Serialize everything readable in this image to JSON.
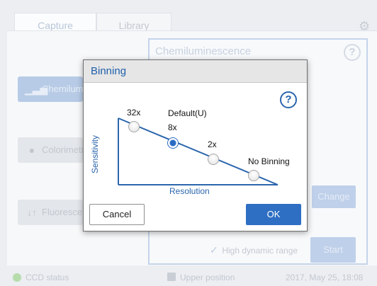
{
  "tabs": [
    {
      "label": "Capture"
    },
    {
      "label": "Library"
    }
  ],
  "sidebar": {
    "items": [
      {
        "label": "Chemiluminescence"
      },
      {
        "label": "Colorimetric"
      },
      {
        "label": "Fluorescence"
      }
    ]
  },
  "main": {
    "panel_title": "Chemiluminescence",
    "help_glyph": "?",
    "change_label": "Change",
    "start_label": "Start",
    "hdr_label": "High dynamic range",
    "hdr_checked": true
  },
  "status": {
    "ccd": "CCD status",
    "position": "Upper position",
    "datetime": "2017, May 25, 18:08"
  },
  "dialog": {
    "title": "Binning",
    "help_glyph": "?",
    "y_axis": "Sensitivity",
    "x_axis": "Resolution",
    "options": [
      {
        "label": "32x",
        "selected": false
      },
      {
        "label": "8x",
        "caption": "Default(U)",
        "selected": true
      },
      {
        "label": "2x",
        "selected": false
      },
      {
        "label": "No Binning",
        "selected": false
      }
    ],
    "cancel_label": "Cancel",
    "ok_label": "OK"
  },
  "colors": {
    "accent": "#2e6fc3",
    "title_text": "#1f5fa9",
    "ccd_status": "#b6dcab"
  }
}
